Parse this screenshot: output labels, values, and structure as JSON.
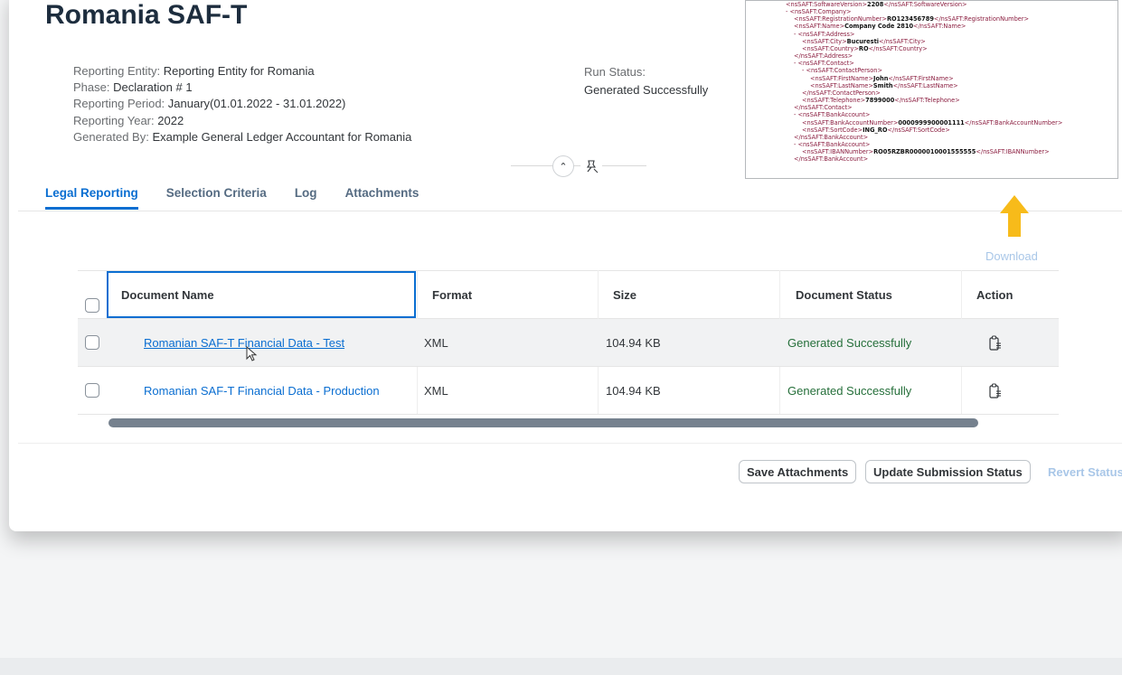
{
  "page": {
    "title": "Romania SAF-T"
  },
  "meta": [
    {
      "label": "Reporting Entity:",
      "value": "Reporting Entity for Romania"
    },
    {
      "label": "Phase:",
      "value": "Declaration # 1"
    },
    {
      "label": "Reporting Period:",
      "value": "January(01.01.2022 - 31.01.2022)"
    },
    {
      "label": "Reporting Year:",
      "value": "2022"
    },
    {
      "label": "Generated By:",
      "value": "Example General Ledger Accountant for Romania"
    }
  ],
  "run_status": {
    "label": "Run Status:",
    "value": "Generated Successfully"
  },
  "header_controls": {
    "collapse_glyph": "⌃",
    "pin_glyph": "✎"
  },
  "xml_preview": {
    "lines": [
      {
        "indent": 0,
        "open": "<nsSAFT:SoftwareVersion>",
        "value": "2208",
        "close": "</nsSAFT:SoftwareVersion>"
      },
      {
        "indent": 0,
        "open": "- <nsSAFT:Company>",
        "value": "",
        "close": ""
      },
      {
        "indent": 1,
        "open": "<nsSAFT:RegistrationNumber>",
        "value": "RO123456789",
        "close": "</nsSAFT:RegistrationNumber>"
      },
      {
        "indent": 1,
        "open": "<nsSAFT:Name>",
        "value": "Company Code 2810",
        "close": "</nsSAFT:Name>"
      },
      {
        "indent": 1,
        "open": "- <nsSAFT:Address>",
        "value": "",
        "close": ""
      },
      {
        "indent": 2,
        "open": "<nsSAFT:City>",
        "value": "Bucuresti",
        "close": "</nsSAFT:City>"
      },
      {
        "indent": 2,
        "open": "<nsSAFT:Country>",
        "value": "RO",
        "close": "</nsSAFT:Country>"
      },
      {
        "indent": 1,
        "open": "</nsSAFT:Address>",
        "value": "",
        "close": ""
      },
      {
        "indent": 1,
        "open": "- <nsSAFT:Contact>",
        "value": "",
        "close": ""
      },
      {
        "indent": 2,
        "open": "- <nsSAFT:ContactPerson>",
        "value": "",
        "close": ""
      },
      {
        "indent": 3,
        "open": "<nsSAFT:FirstName>",
        "value": "John",
        "close": "</nsSAFT:FirstName>"
      },
      {
        "indent": 3,
        "open": "<nsSAFT:LastName>",
        "value": "Smith",
        "close": "</nsSAFT:LastName>"
      },
      {
        "indent": 2,
        "open": "</nsSAFT:ContactPerson>",
        "value": "",
        "close": ""
      },
      {
        "indent": 2,
        "open": "<nsSAFT:Telephone>",
        "value": "7899000",
        "close": "</nsSAFT:Telephone>"
      },
      {
        "indent": 1,
        "open": "</nsSAFT:Contact>",
        "value": "",
        "close": ""
      },
      {
        "indent": 1,
        "open": "- <nsSAFT:BankAccount>",
        "value": "",
        "close": ""
      },
      {
        "indent": 2,
        "open": "<nsSAFT:BankAccountNumber>",
        "value": "0000999900001111",
        "close": "</nsSAFT:BankAccountNumber>"
      },
      {
        "indent": 2,
        "open": "<nsSAFT:SortCode>",
        "value": "ING_RO",
        "close": "</nsSAFT:SortCode>"
      },
      {
        "indent": 1,
        "open": "</nsSAFT:BankAccount>",
        "value": "",
        "close": ""
      },
      {
        "indent": 1,
        "open": "- <nsSAFT:BankAccount>",
        "value": "",
        "close": ""
      },
      {
        "indent": 2,
        "open": "<nsSAFT:IBANNumber>",
        "value": "RO05RZBR0000010001555555",
        "close": "</nsSAFT:IBANNumber>"
      },
      {
        "indent": 1,
        "open": "</nsSAFT:BankAccount>",
        "value": "",
        "close": ""
      }
    ]
  },
  "tabs": [
    {
      "label": "Legal Reporting",
      "active": true
    },
    {
      "label": "Selection Criteria",
      "active": false
    },
    {
      "label": "Log",
      "active": false
    },
    {
      "label": "Attachments",
      "active": false
    }
  ],
  "download_label": "Download",
  "table": {
    "columns": [
      "Document Name",
      "Format",
      "Size",
      "Document Status",
      "Action"
    ],
    "rows": [
      {
        "name": "Romanian SAF-T Financial Data - Test",
        "format": "XML",
        "size": "104.94 KB",
        "status": "Generated Successfully",
        "action_icon": "clipboard-icon"
      },
      {
        "name": "Romanian SAF-T Financial Data - Production",
        "format": "XML",
        "size": "104.94 KB",
        "status": "Generated Successfully",
        "action_icon": "clipboard-icon"
      }
    ]
  },
  "footer": {
    "save_attachments": "Save Attachments",
    "update_submission_status": "Update Submission Status",
    "revert_status": "Revert Status"
  },
  "colors": {
    "accent": "#0a6ed1",
    "success": "#256f3a",
    "title": "#1d2d3e",
    "arrow": "#f7bb1a",
    "disabled": "#a9c7e8"
  }
}
